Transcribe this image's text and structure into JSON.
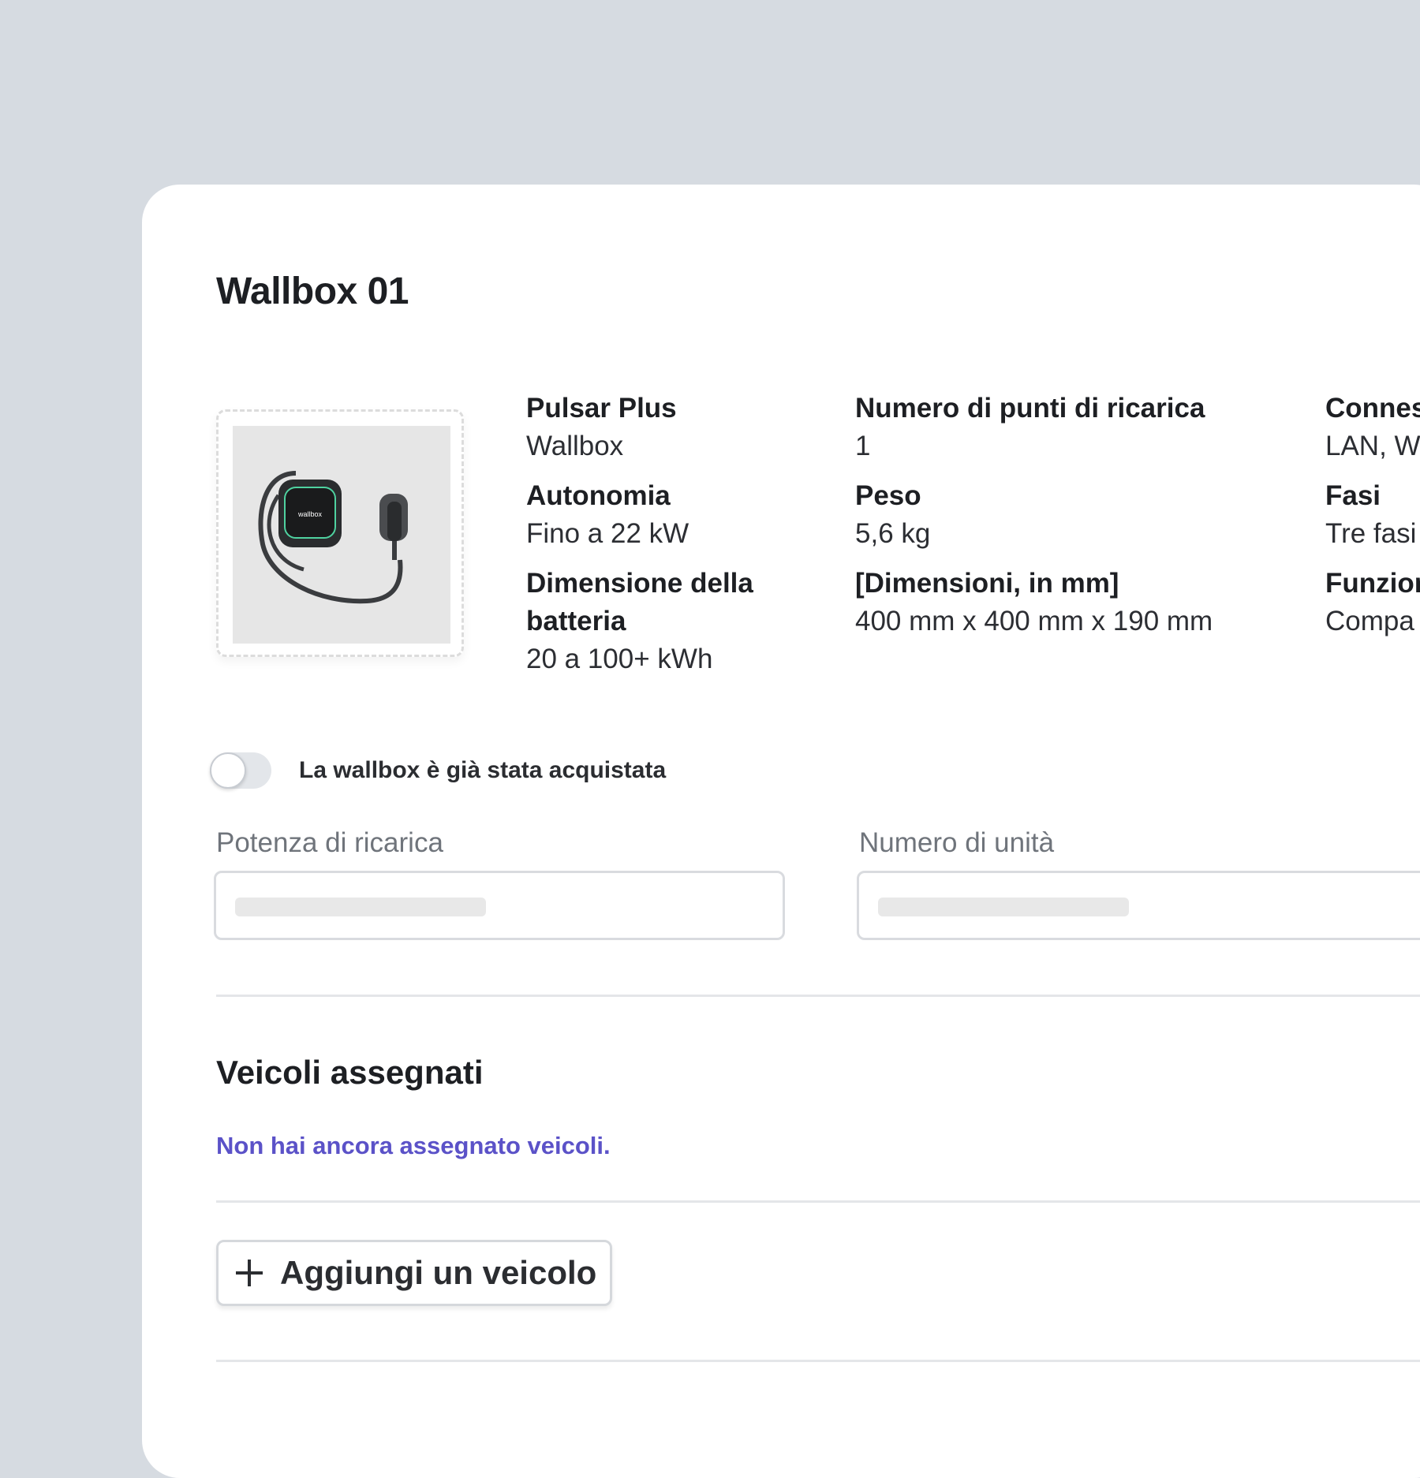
{
  "title": "Wallbox 01",
  "product_image": {
    "brand_text": "wallbox"
  },
  "specs": {
    "col1": [
      {
        "label": "Pulsar Plus",
        "value": "Wallbox"
      },
      {
        "label": "Autonomia",
        "value": "Fino a 22 kW"
      },
      {
        "label": "Dimensione della batteria",
        "value": "20 a 100+ kWh"
      }
    ],
    "col2": [
      {
        "label": "Numero di punti di ricarica",
        "value": "1"
      },
      {
        "label": "Peso",
        "value": "5,6 kg"
      },
      {
        "label": "[Dimensioni, in mm]",
        "value": "400 mm x 400 mm x 190 mm"
      }
    ],
    "col3": [
      {
        "label": "Connes",
        "value": "LAN, W"
      },
      {
        "label": "Fasi",
        "value": "Tre fasi"
      },
      {
        "label": "Funzion",
        "value": "Compa"
      }
    ]
  },
  "toggle": {
    "label": "La wallbox è già stata acquistata",
    "checked": false
  },
  "fields": [
    {
      "label": "Potenza di ricarica"
    },
    {
      "label": "Numero di unità"
    }
  ],
  "vehicles": {
    "title": "Veicoli assegnati",
    "empty_message": "Non hai ancora assegnato veicoli.",
    "add_button_label": "Aggiungi un veicolo"
  },
  "colors": {
    "background": "#d6dbe1",
    "card": "#ffffff",
    "accent_link": "#5b52c8"
  }
}
